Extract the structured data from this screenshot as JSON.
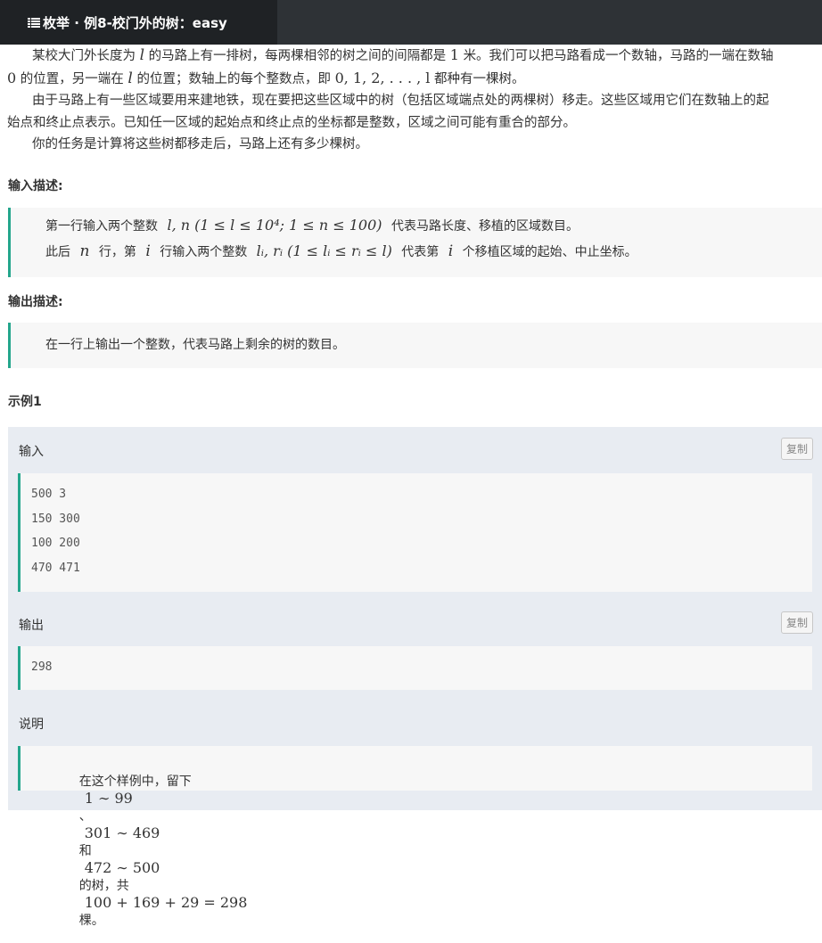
{
  "tab": {
    "title": "枚举 · 例8-校门外的树：easy",
    "icon": "list-icon"
  },
  "description": {
    "p1_a": "某校大门外长度为",
    "p1_b": "的马路上有一排树，每两棵相邻的树之间的间隔都是",
    "p1_c": "米。我们可以把马路看成一个数轴，马路的一端在数轴",
    "p1_d": "的位置，另一端在",
    "p1_e": "的位置；数轴上的每个整数点，即",
    "p1_f": "都种有一棵树。",
    "var_l": "l",
    "one": "1",
    "zero": "0",
    "seq": "0, 1, 2, . . . , l",
    "p2": "由于马路上有一些区域要用来建地铁，现在要把这些区域中的树（包括区域端点处的两棵树）移走。这些区域用它们在数轴上的起",
    "p2b": "始点和终止点表示。已知任一区域的起始点和终止点的坐标都是整数，区域之间可能有重合的部分。",
    "p3": "你的任务是计算将这些树都移走后，马路上还有多少棵树。"
  },
  "input_section": {
    "title": "输入描述:",
    "line1_a": "第一行输入两个整数",
    "line1_math": "l, n (1 ≤ l ≤ 10⁴; 1 ≤ n ≤ 100)",
    "line1_b": "代表马路长度、移植的区域数目。",
    "line2_a": "此后",
    "line2_n": "n",
    "line2_b": "行，第",
    "line2_i": "i",
    "line2_c": "行输入两个整数",
    "line2_math": "lᵢ, rᵢ (1 ≤ lᵢ ≤ rᵢ ≤ l)",
    "line2_d": "代表第",
    "line2_i2": "i",
    "line2_e": "个移植区域的起始、中止坐标。"
  },
  "output_section": {
    "title": "输出描述:",
    "text": "在一行上输出一个整数，代表马路上剩余的树的数目。"
  },
  "example": {
    "title": "示例1",
    "input_label": "输入",
    "copy_label": "复制",
    "input_lines": [
      "500 3",
      "150 300",
      "100 200",
      "470 471"
    ],
    "output_label": "输出",
    "output_lines": [
      "298"
    ],
    "note_label": "说明",
    "note_a": "在这个样例中，留下",
    "note_m1": "1 ∼ 99",
    "note_b": "、",
    "note_m2": "301 ∼ 469",
    "note_c": "和",
    "note_m3": "472 ∼ 500",
    "note_d": "的树，共",
    "note_m4": "100 + 169 + 29 = 298",
    "note_e": "棵。"
  },
  "colors": {
    "topbar": "#2e3236",
    "tab_active": "#1f2225",
    "accent": "#24a68c",
    "sample_bg": "#e8ecf2"
  }
}
